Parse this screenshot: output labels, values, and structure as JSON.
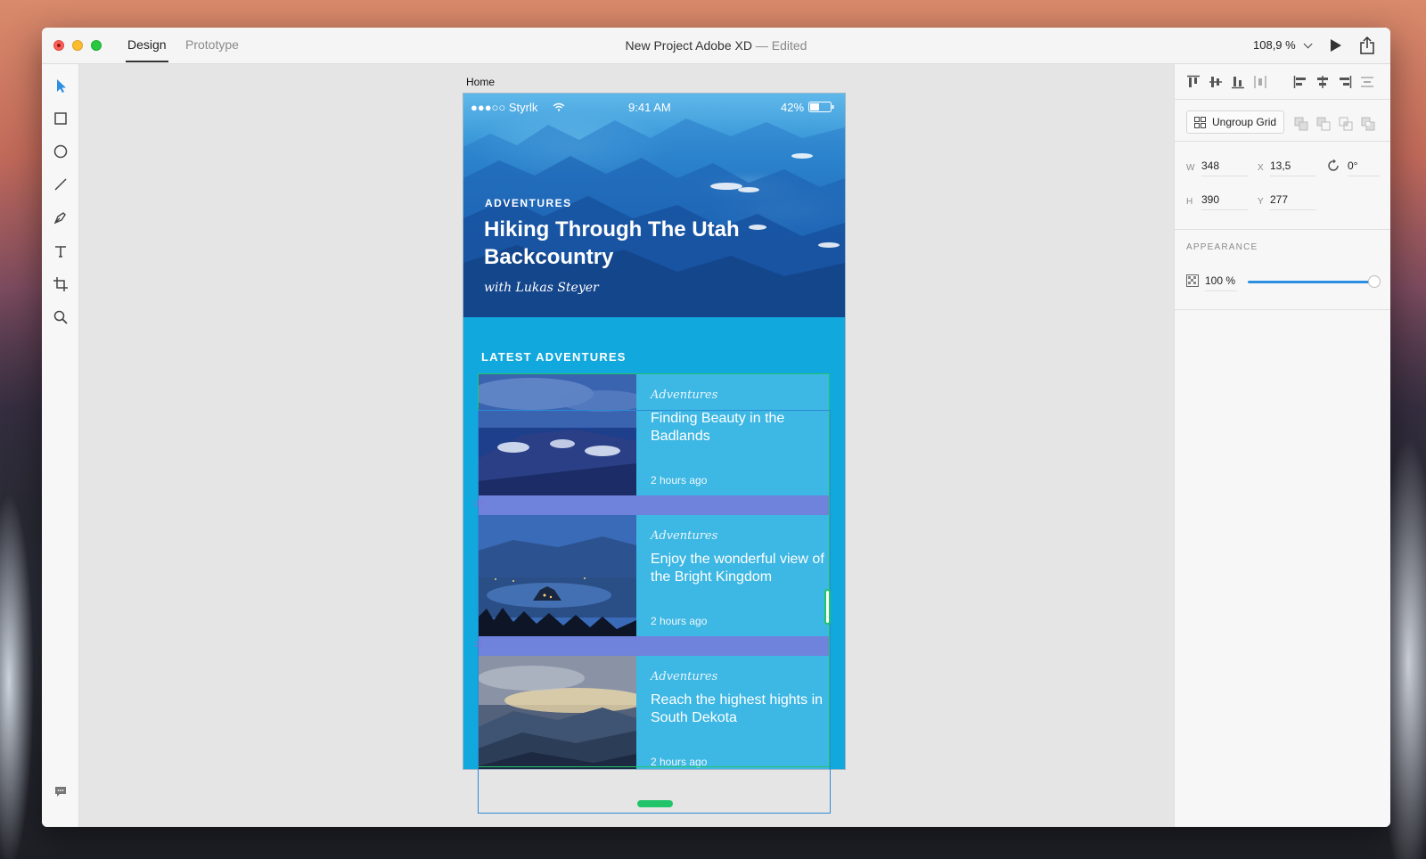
{
  "window": {
    "tabs": [
      {
        "label": "Design",
        "active": true
      },
      {
        "label": "Prototype",
        "active": false
      }
    ],
    "title": "New Project Adobe XD",
    "title_status": " — Edited",
    "zoom": "108,9 %"
  },
  "toolbar": {
    "tools": [
      "select-icon",
      "rectangle-icon",
      "ellipse-icon",
      "line-icon",
      "pen-icon",
      "text-icon",
      "artboard-icon",
      "zoom-icon"
    ],
    "bottom": "comment-icon"
  },
  "canvas": {
    "artboard_label": "Home",
    "status_bar": {
      "carrier": "●●●○○ Styrlk",
      "time": "9:41 AM",
      "battery": "42%"
    },
    "hero": {
      "kicker": "ADVENTURES",
      "title": "Hiking  Through The Utah Backcountry",
      "byline": "with Lukas Steyer"
    },
    "latest_label": "LATEST ADVENTURES",
    "cards": [
      {
        "kicker": "Adventures",
        "title": "Finding Beauty in the Badlands",
        "time": "2 hours ago"
      },
      {
        "kicker": "Adventures",
        "title": "Enjoy the wonderful view of the Bright Kingdom",
        "time": "2 hours ago"
      },
      {
        "kicker": "Adventures",
        "title": "Reach the highest hights in South Dekota",
        "time": "2 hours ago"
      }
    ],
    "gap_value": "20",
    "colors": {
      "artboard_bg": "#11a8dd",
      "card_bg": "#3db7e4",
      "gap_bg": "#6f82dc",
      "selection": "#22c46a"
    }
  },
  "inspector": {
    "ungroup_label": "Ungroup Grid",
    "w_label": "W",
    "w_value": "348",
    "x_label": "X",
    "x_value": "13,5",
    "rotation_value": "0°",
    "h_label": "H",
    "h_value": "390",
    "y_label": "Y",
    "y_value": "277",
    "appearance_label": "APPEARANCE",
    "opacity_value": "100 %",
    "opacity_level": 1.0
  }
}
